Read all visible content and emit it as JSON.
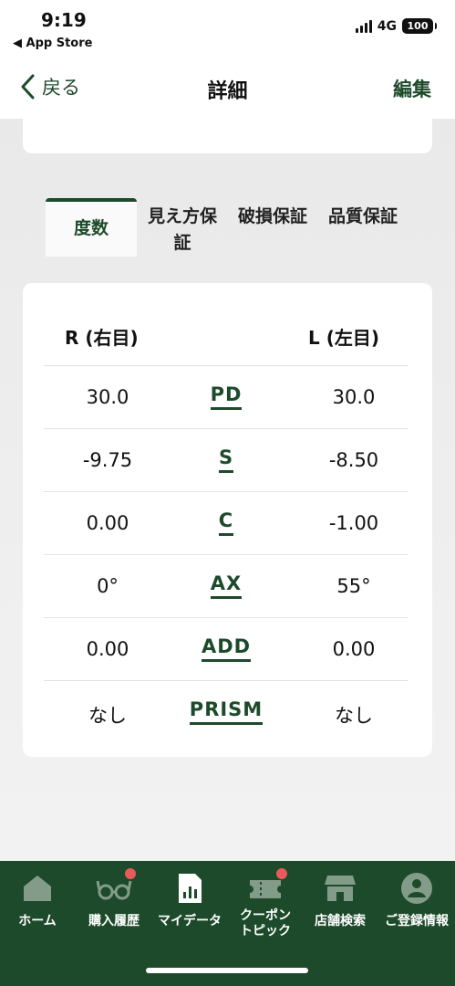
{
  "status": {
    "time": "9:19",
    "back_app": "◀ App Store",
    "network": "4G",
    "battery": "100"
  },
  "nav": {
    "back_label": "戻る",
    "title": "詳細",
    "edit_label": "編集"
  },
  "tabs": [
    {
      "label": "度数"
    },
    {
      "label": "見え方保証"
    },
    {
      "label": "破損保証"
    },
    {
      "label": "品質保証"
    }
  ],
  "table": {
    "header_r": "R (右目)",
    "header_l": "L (左目)",
    "rows": [
      {
        "r": "30.0",
        "label": "PD",
        "l": "30.0"
      },
      {
        "r": "-9.75",
        "label": "S",
        "l": "-8.50"
      },
      {
        "r": "0.00",
        "label": "C",
        "l": "-1.00"
      },
      {
        "r": "0°",
        "label": "AX",
        "l": "55°"
      },
      {
        "r": "0.00",
        "label": "ADD",
        "l": "0.00"
      },
      {
        "r": "なし",
        "label": "PRISM",
        "l": "なし"
      }
    ]
  },
  "tabbar": [
    {
      "label": "ホーム",
      "icon": "home-icon",
      "badge": false
    },
    {
      "label": "購入履歴",
      "icon": "glasses-icon",
      "badge": true
    },
    {
      "label": "マイデータ",
      "icon": "chart-document-icon",
      "badge": false
    },
    {
      "label": "クーポン\nトピック",
      "icon": "ticket-icon",
      "badge": true
    },
    {
      "label": "店舗検索",
      "icon": "store-icon",
      "badge": false
    },
    {
      "label": "ご登録情報",
      "icon": "profile-icon",
      "badge": false
    }
  ],
  "colors": {
    "brand": "#1d4a2a",
    "badge": "#e85a5a"
  }
}
